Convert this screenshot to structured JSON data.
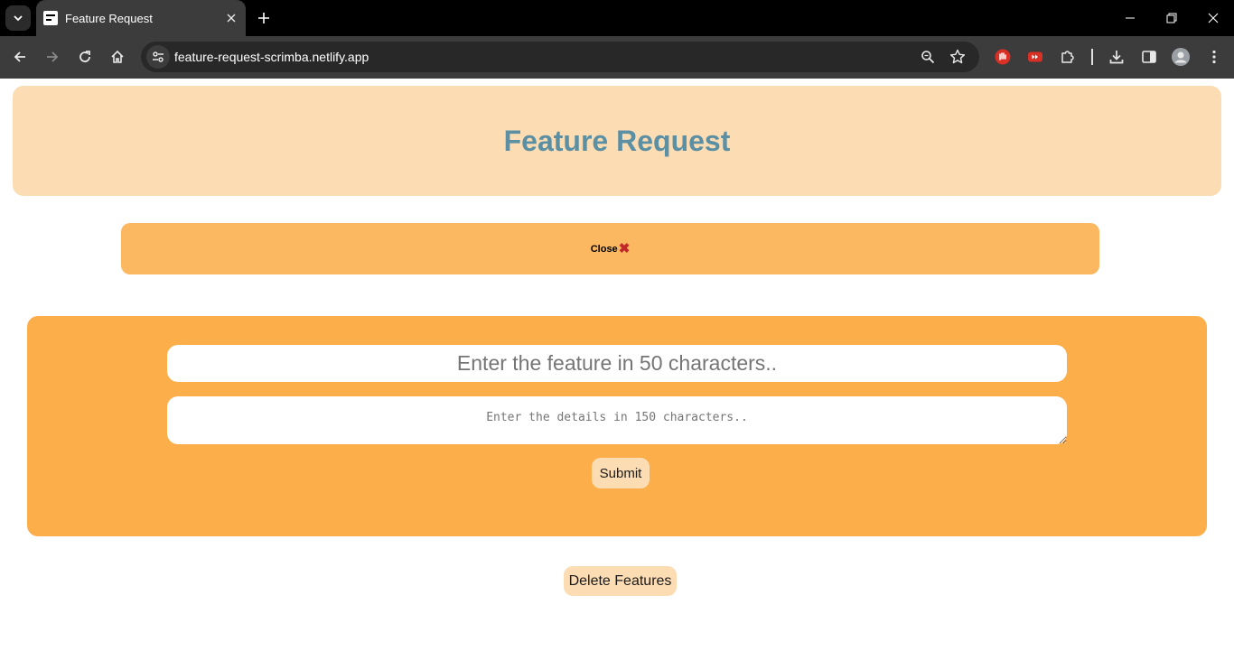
{
  "browser": {
    "tab_title": "Feature Request",
    "url": "feature-request-scrimba.netlify.app",
    "icons": {
      "tab_search": "chevron-down-icon",
      "tab_favicon": "scrimba-favicon-icon",
      "tab_close": "close-icon",
      "new_tab": "plus-icon",
      "minimize": "minimize-icon",
      "restore": "restore-icon",
      "close_window": "close-icon",
      "back": "arrow-left-icon",
      "forward": "arrow-right-icon",
      "reload": "reload-icon",
      "home": "home-icon",
      "site_info": "tune-icon",
      "zoom": "zoom-icon",
      "bookmark": "star-icon",
      "extensions": [
        "hand-stop-icon",
        "youtube-ext-icon",
        "puzzle-icon"
      ],
      "downloads": "download-icon",
      "side_panel": "side-panel-icon",
      "profile": "avatar-icon",
      "menu": "kebab-menu-icon"
    }
  },
  "page": {
    "title": "Feature Request",
    "close_bar": {
      "label": "Close",
      "icon": "cross-mark-icon",
      "icon_glyph": "✖",
      "icon_color": "#c0282a"
    },
    "form": {
      "feature_placeholder": "Enter the feature in 50 characters..",
      "details_placeholder": "Enter the details in 150 characters..",
      "submit_label": "Submit"
    },
    "delete_label": "Delete Features"
  },
  "colors": {
    "header_bg": "#fcdcb3",
    "title_color": "#5b8fa3",
    "close_bar_bg": "#fcb861",
    "form_bg": "#fbae4a",
    "button_bg": "#fcdcb3"
  }
}
